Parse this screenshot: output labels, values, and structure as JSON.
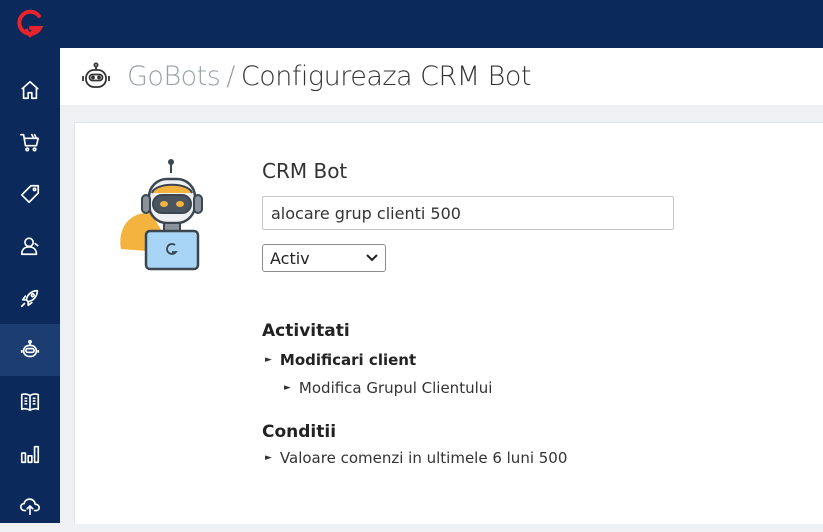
{
  "app": {
    "logo_icon": "gomag-logo-icon",
    "brand_color": "#e6242b",
    "sidebar_color": "#0b2a5b"
  },
  "sidebar": {
    "items": [
      {
        "icon": "home-icon",
        "active": false
      },
      {
        "icon": "cart-icon",
        "active": false
      },
      {
        "icon": "tag-icon",
        "active": false
      },
      {
        "icon": "user-icon",
        "active": false
      },
      {
        "icon": "rocket-icon",
        "active": false
      },
      {
        "icon": "robot-icon",
        "active": true
      },
      {
        "icon": "book-icon",
        "active": false
      },
      {
        "icon": "chart-icon",
        "active": false
      },
      {
        "icon": "cloud-upload-icon",
        "active": false
      }
    ]
  },
  "header": {
    "icon": "robot-icon",
    "breadcrumb_root": "GoBots",
    "separator": "/",
    "page_title": "Configureaza CRM Bot"
  },
  "bot": {
    "illustration": "robot-with-laptop-illustration",
    "name": "CRM Bot",
    "rule_name": "alocare grup clienti 500",
    "status": "Activ",
    "status_options": [
      "Activ"
    ]
  },
  "activities": {
    "title": "Activitati",
    "group": "Modificari client",
    "item": "Modifica Grupul Clientului"
  },
  "conditions": {
    "title": "Conditii",
    "item": "Valoare comenzi in ultimele 6 luni 500"
  }
}
